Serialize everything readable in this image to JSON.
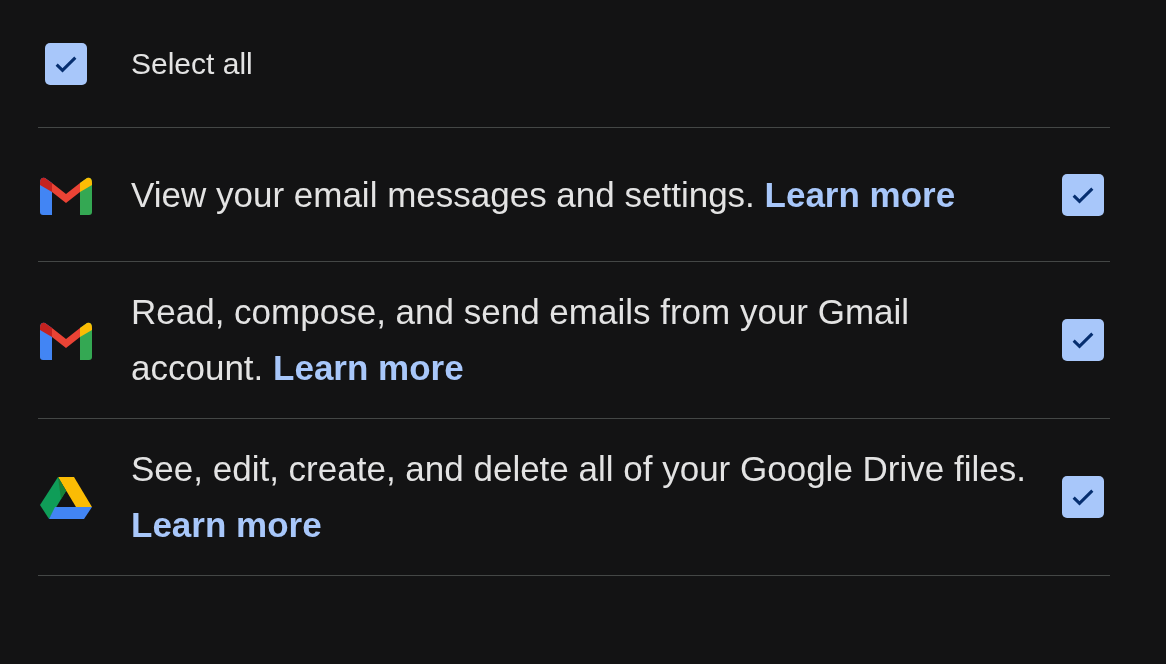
{
  "select_all": {
    "label": "Select all",
    "checked": true
  },
  "permissions": [
    {
      "kind": "gmail",
      "text": "View your email messages and settings.",
      "link": "Learn more",
      "checked": true
    },
    {
      "kind": "gmail",
      "text": "Read, compose, and send emails from your Gmail account.",
      "link": "Learn more",
      "checked": true
    },
    {
      "kind": "drive",
      "text": "See, edit, create, and delete all of your Google Drive files.",
      "link": "Learn more",
      "checked": true
    }
  ]
}
